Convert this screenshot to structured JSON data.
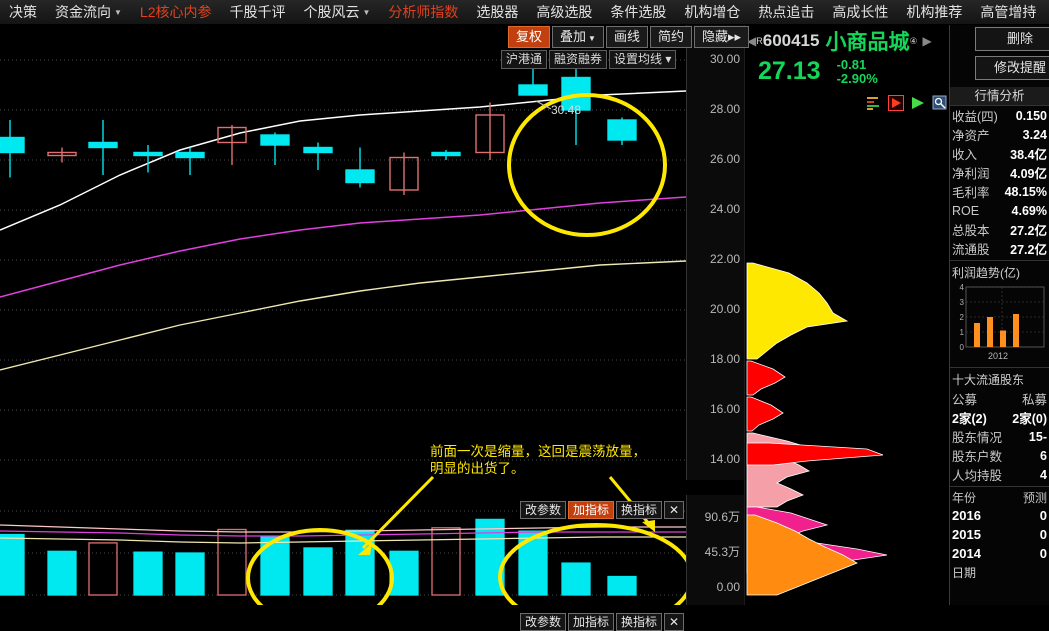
{
  "menubar": {
    "items": [
      {
        "label": "决策",
        "red": false,
        "caret": false
      },
      {
        "label": "资金流向",
        "red": false,
        "caret": true
      },
      {
        "label": "L2核心内参",
        "red": true,
        "caret": false
      },
      {
        "label": "千股千评",
        "red": false,
        "caret": false
      },
      {
        "label": "个股风云",
        "red": false,
        "caret": true
      },
      {
        "label": "分析师指数",
        "red": true,
        "caret": false
      },
      {
        "label": "选股器",
        "red": false,
        "caret": false
      },
      {
        "label": "高级选股",
        "red": false,
        "caret": false
      },
      {
        "label": "条件选股",
        "red": false,
        "caret": false
      },
      {
        "label": "机构增仓",
        "red": false,
        "caret": false
      },
      {
        "label": "热点追击",
        "red": false,
        "caret": false
      },
      {
        "label": "高成长性",
        "red": false,
        "caret": false
      },
      {
        "label": "机构推荐",
        "red": false,
        "caret": false
      },
      {
        "label": "高管增持",
        "red": false,
        "caret": false
      }
    ]
  },
  "chart_toolbar": {
    "buttons": [
      {
        "label": "复权",
        "active": true,
        "caret": false
      },
      {
        "label": "叠加",
        "active": false,
        "caret": true
      },
      {
        "label": "画线",
        "active": false,
        "caret": false
      },
      {
        "label": "简约",
        "active": false,
        "caret": false
      },
      {
        "label": "隐藏",
        "active": false,
        "caret": false,
        "suffix": "▸▸"
      }
    ]
  },
  "chart_toolbar2": {
    "buttons": [
      {
        "label": "沪港通",
        "caret": false
      },
      {
        "label": "融资融券",
        "caret": false
      },
      {
        "label": "设置均线",
        "caret": true
      }
    ]
  },
  "volume_toolbar": {
    "buttons": [
      {
        "label": "改参数",
        "on": false
      },
      {
        "label": "加指标",
        "on": true
      },
      {
        "label": "换指标",
        "on": false
      },
      {
        "label": "✕",
        "on": false
      }
    ]
  },
  "volume_toolbar_bottom": {
    "buttons": [
      {
        "label": "改参数",
        "on": false
      },
      {
        "label": "加指标",
        "on": false
      },
      {
        "label": "换指标",
        "on": false
      },
      {
        "label": "✕",
        "on": false
      }
    ]
  },
  "annotation": {
    "line1": "前面一次是缩量，这回是震荡放量，",
    "line2": "明显的出货了。"
  },
  "price_label": "30.48",
  "stock": {
    "market_flag": "R",
    "code": "600415",
    "name": "小商品城",
    "name_sup": "④",
    "price": "27.13",
    "change": "-0.81",
    "change_pct": "-2.90%",
    "prev_arrow": "◀",
    "next_arrow": "▶"
  },
  "top_buttons": [
    {
      "label": "删除"
    },
    {
      "label": "修改提醒"
    }
  ],
  "icon_row": [
    "bars-icon",
    "red-play-icon",
    "green-play-icon",
    "magnifier-icon"
  ],
  "panel": {
    "quote_analysis_title": "行情分析",
    "financials": [
      {
        "k": "收益(四)",
        "v": "0.150"
      },
      {
        "k": "净资产",
        "v": "3.24"
      },
      {
        "k": "收入",
        "v": "38.4亿"
      },
      {
        "k": "净利润",
        "v": "4.09亿"
      },
      {
        "k": "毛利率",
        "v": "48.15%"
      },
      {
        "k": "ROE",
        "v": "4.69%"
      },
      {
        "k": "总股本",
        "v": "27.2亿"
      },
      {
        "k": "流通股",
        "v": "27.2亿"
      }
    ],
    "profit_trend_title": "利润趋势(亿)",
    "holders_title": "十大流通股东",
    "fund_cols": [
      "公募",
      "私募"
    ],
    "fund_vals": [
      "2家(2)",
      "2家(0)"
    ],
    "holder_rows": [
      {
        "k": "股东情况",
        "v": "15-"
      },
      {
        "k": "股东户数",
        "v": "6"
      },
      {
        "k": "人均持股",
        "v": "4"
      }
    ],
    "year_header": {
      "left": "年份",
      "right": "预测"
    },
    "year_rows": [
      {
        "year": "2016",
        "v": "0"
      },
      {
        "year": "2015",
        "v": "0"
      },
      {
        "year": "2014",
        "v": "0"
      }
    ],
    "date_label": "日期"
  },
  "price_axis": {
    "ticks": [
      "30.00",
      "28.00",
      "26.00",
      "24.00",
      "22.00",
      "20.00",
      "18.00",
      "16.00",
      "14.00"
    ]
  },
  "volume_axis": {
    "ticks": [
      "90.6万",
      "45.3万",
      "0.00"
    ]
  },
  "profit_chart": {
    "yticks": [
      "4",
      "3",
      "2",
      "1",
      "0"
    ],
    "values": [
      1.6,
      2.0,
      1.1,
      2.2
    ],
    "xlabel": "2012"
  },
  "chart_data": {
    "type": "candlestick",
    "title": "600415 小商品城",
    "ylabel": "",
    "ylim": [
      13.2,
      31.0
    ],
    "price_ticks": [
      30,
      28,
      26,
      24,
      22,
      20,
      18,
      16,
      14
    ],
    "volume_ticks": [
      0,
      45.3,
      90.6
    ],
    "volume_unit": "万",
    "candles": [
      {
        "x": 10,
        "open": 26.3,
        "high": 27.6,
        "low": 25.3,
        "close": 26.9,
        "dir": "down"
      },
      {
        "x": 62,
        "open": 26.3,
        "high": 26.5,
        "low": 25.9,
        "close": 26.2,
        "dir": "up"
      },
      {
        "x": 103,
        "open": 26.5,
        "high": 27.6,
        "low": 25.4,
        "close": 26.7,
        "dir": "down"
      },
      {
        "x": 148,
        "open": 26.2,
        "high": 26.6,
        "low": 25.5,
        "close": 26.3,
        "dir": "down"
      },
      {
        "x": 190,
        "open": 26.1,
        "high": 26.5,
        "low": 25.4,
        "close": 26.3,
        "dir": "down"
      },
      {
        "x": 232,
        "open": 26.7,
        "high": 27.4,
        "low": 25.8,
        "close": 27.3,
        "dir": "up"
      },
      {
        "x": 275,
        "open": 26.6,
        "high": 27.1,
        "low": 25.8,
        "close": 27.0,
        "dir": "down"
      },
      {
        "x": 318,
        "open": 26.3,
        "high": 26.7,
        "low": 25.6,
        "close": 26.5,
        "dir": "down"
      },
      {
        "x": 360,
        "open": 25.6,
        "high": 26.5,
        "low": 24.9,
        "close": 25.1,
        "dir": "down"
      },
      {
        "x": 404,
        "open": 26.1,
        "high": 26.3,
        "low": 24.6,
        "close": 24.8,
        "dir": "up"
      },
      {
        "x": 446,
        "open": 26.2,
        "high": 26.4,
        "low": 26.0,
        "close": 26.3,
        "dir": "down"
      },
      {
        "x": 490,
        "open": 27.8,
        "high": 28.3,
        "low": 26.0,
        "close": 26.3,
        "dir": "up"
      },
      {
        "x": 533,
        "open": 29.0,
        "high": 29.9,
        "low": 28.6,
        "close": 28.6,
        "dir": "down"
      },
      {
        "x": 576,
        "open": 29.3,
        "high": 30.2,
        "low": 26.6,
        "close": 28.0,
        "dir": "down"
      },
      {
        "x": 622,
        "open": 27.6,
        "high": 27.7,
        "low": 26.6,
        "close": 26.8,
        "dir": "down"
      }
    ],
    "volumes": [
      {
        "x": 10,
        "v": 72,
        "dir": "down"
      },
      {
        "x": 62,
        "v": 52,
        "dir": "down"
      },
      {
        "x": 103,
        "v": 62,
        "dir": "up"
      },
      {
        "x": 148,
        "v": 51,
        "dir": "down"
      },
      {
        "x": 190,
        "v": 50,
        "dir": "down"
      },
      {
        "x": 232,
        "v": 78,
        "dir": "up"
      },
      {
        "x": 275,
        "v": 70,
        "dir": "down"
      },
      {
        "x": 318,
        "v": 56,
        "dir": "down"
      },
      {
        "x": 360,
        "v": 77,
        "dir": "down"
      },
      {
        "x": 404,
        "v": 52,
        "dir": "down"
      },
      {
        "x": 446,
        "v": 80,
        "dir": "up"
      },
      {
        "x": 490,
        "v": 90,
        "dir": "down"
      },
      {
        "x": 533,
        "v": 76,
        "dir": "down"
      },
      {
        "x": 576,
        "v": 38,
        "dir": "down"
      },
      {
        "x": 622,
        "v": 22,
        "dir": "down"
      }
    ],
    "ma_lines": [
      {
        "name": "MA-white",
        "color": "#ffffff"
      },
      {
        "name": "MA-magenta",
        "color": "#e040e0"
      },
      {
        "name": "MA-paleyellow",
        "color": "#efe8b0"
      }
    ],
    "markups": [
      {
        "type": "circle",
        "target": "price-candles",
        "color": "#ffe800"
      },
      {
        "type": "circle",
        "target": "volume-bars-left",
        "color": "#ffe800"
      },
      {
        "type": "circle",
        "target": "volume-bars-right",
        "color": "#ffe800"
      },
      {
        "type": "arrow",
        "color": "#ffe800"
      }
    ]
  },
  "colors": {
    "up": "#ff5a5a",
    "down": "#00e8f0",
    "accent_red": "#c2400f",
    "markup_yellow": "#ffe800",
    "green_text": "#16d65a"
  }
}
